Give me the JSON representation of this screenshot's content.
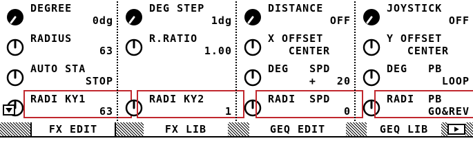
{
  "columns": [
    {
      "params": [
        {
          "name": "DEGREE",
          "value": "0dg",
          "knob": "filled"
        },
        {
          "name": "RADIUS",
          "value": "63",
          "knob": "outline"
        },
        {
          "name": "AUTO STA",
          "value": "STOP",
          "knob": "outline"
        },
        {
          "name": "RADI KY1",
          "value": "63",
          "knob": "outline",
          "highlighted": true
        }
      ]
    },
    {
      "params": [
        {
          "name": "DEG STEP",
          "value": "1dg",
          "knob": "filled"
        },
        {
          "name": "R.RATIO",
          "value": "1.00",
          "knob": "outline"
        },
        {
          "name": "",
          "value": "",
          "knob": "none"
        },
        {
          "name": "RADI KY2",
          "value": "1",
          "knob": "outline",
          "highlighted": true
        }
      ]
    },
    {
      "params": [
        {
          "name": "DISTANCE",
          "value": "OFF",
          "knob": "filled"
        },
        {
          "name": "X OFFSET",
          "value": "CENTER",
          "knob": "outline",
          "center": true
        },
        {
          "name": "DEG   SPD",
          "value": "+   20",
          "knob": "outline"
        },
        {
          "name": "RADI  SPD",
          "value": "0",
          "knob": "outline",
          "highlighted": true
        }
      ]
    },
    {
      "params": [
        {
          "name": "JOYSTICK",
          "value": "OFF",
          "knob": "filled"
        },
        {
          "name": "Y OFFSET",
          "value": "CENTER",
          "knob": "outline",
          "center": true
        },
        {
          "name": "DEG   PB",
          "value": "LOOP",
          "knob": "outline"
        },
        {
          "name": "RADI  PB",
          "value": "GO&REV",
          "knob": "outline",
          "highlighted": true
        }
      ]
    }
  ],
  "tabs": [
    {
      "label": "FX EDIT",
      "active": true
    },
    {
      "label": "FX LIB",
      "active": false
    },
    {
      "label": "GEQ EDIT",
      "active": false
    },
    {
      "label": "GEQ LIB",
      "active": false
    }
  ],
  "icons": {
    "scroll": "down-arrow-icon",
    "more_tabs": "right-arrow-icon"
  },
  "colors": {
    "highlight": "#c0272d",
    "foreground": "#000000",
    "background": "#ffffff"
  }
}
